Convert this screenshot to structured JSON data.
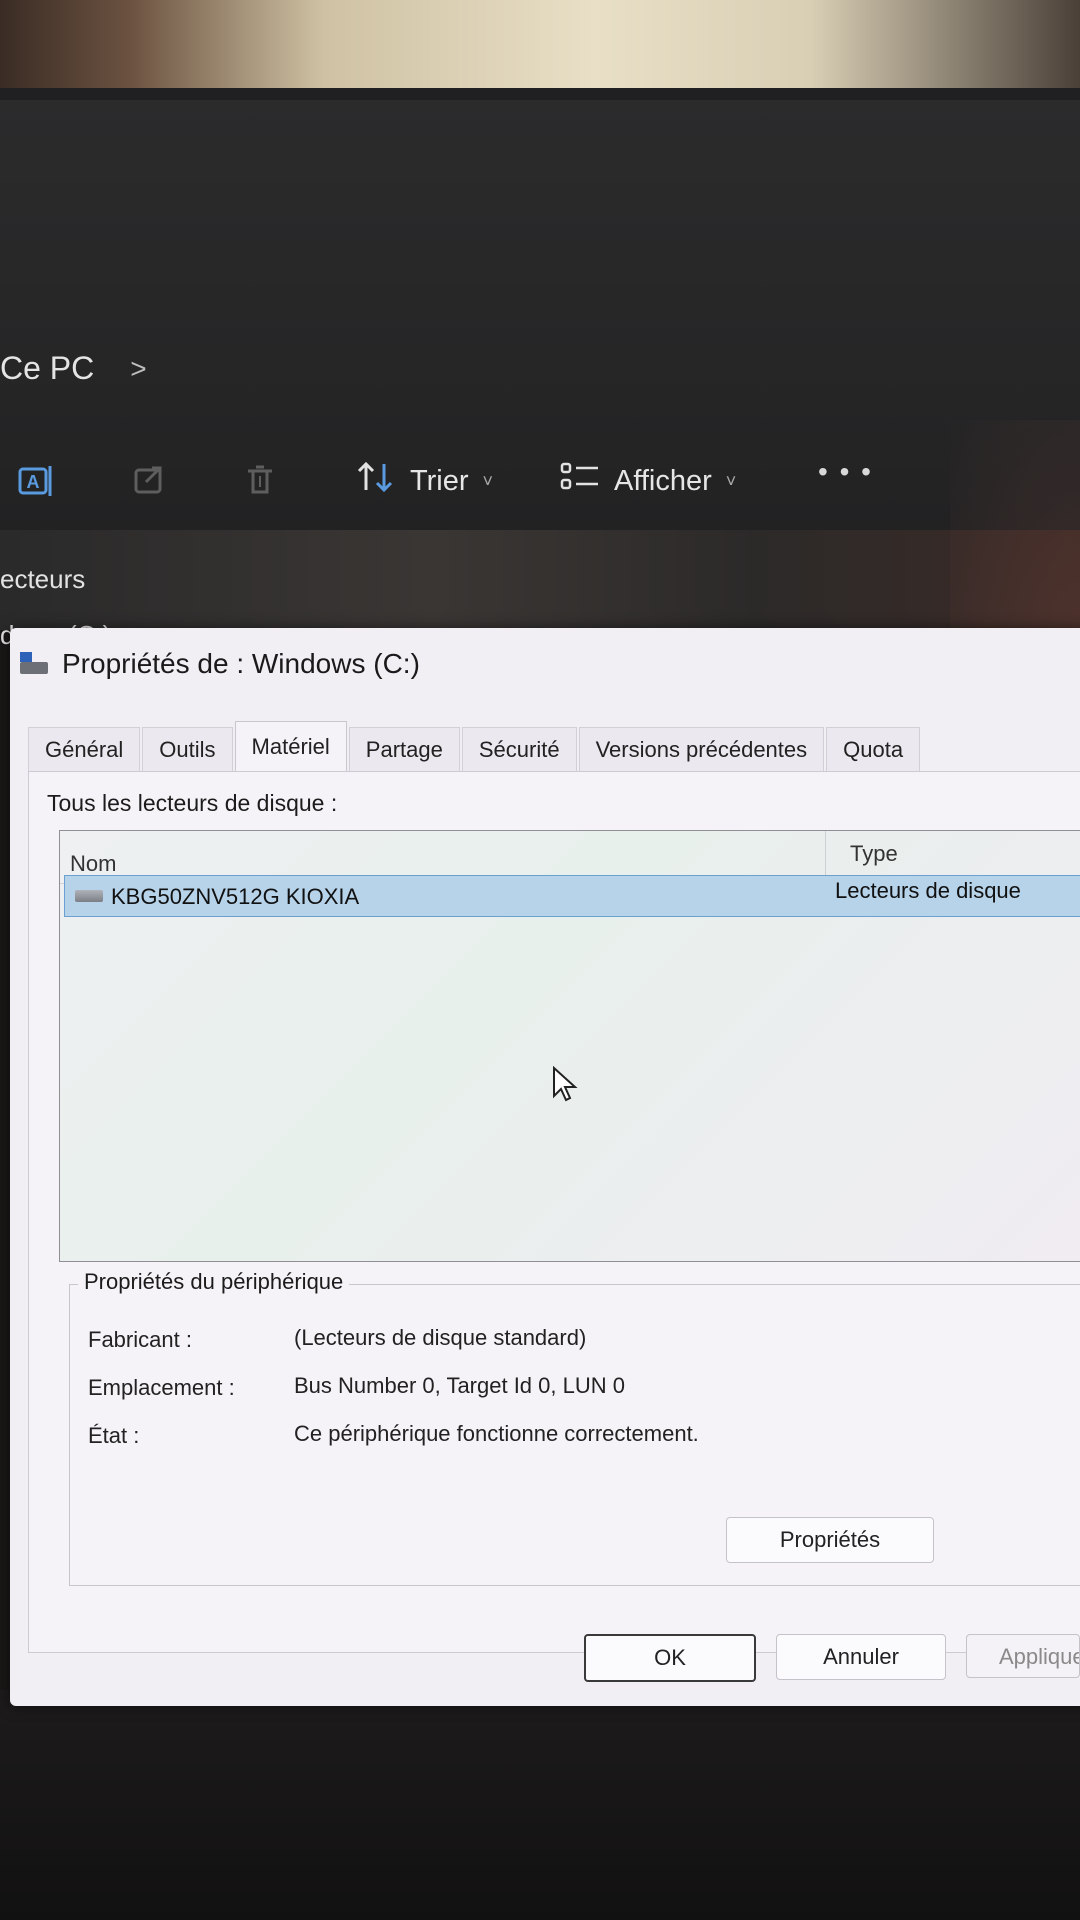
{
  "explorer": {
    "breadcrumb": "Ce PC",
    "breadcrumb_sep": ">",
    "toolbar": {
      "sort_label": "Trier",
      "view_label": "Afficher",
      "more_label": "• • •"
    },
    "nav": {
      "drives_label": "ecteurs",
      "windows_label": "dows (C:)"
    }
  },
  "dialog": {
    "title": "Propriétés de : Windows (C:)",
    "tabs": [
      "Général",
      "Outils",
      "Matériel",
      "Partage",
      "Sécurité",
      "Versions précédentes",
      "Quota"
    ],
    "active_tab": "Matériel",
    "list_label": "Tous les lecteurs de disque :",
    "columns": {
      "name": "Nom",
      "type": "Type"
    },
    "rows": [
      {
        "name": "KBG50ZNV512G KIOXIA",
        "type": "Lecteurs de disque"
      }
    ],
    "device_props": {
      "title": "Propriétés du périphérique",
      "manufacturer_label": "Fabricant :",
      "manufacturer_value": "(Lecteurs de disque standard)",
      "location_label": "Emplacement :",
      "location_value": "Bus Number 0, Target Id 0, LUN 0",
      "status_label": "État :",
      "status_value": "Ce périphérique fonctionne correctement.",
      "properties_button": "Propriétés"
    },
    "buttons": {
      "ok": "OK",
      "cancel": "Annuler",
      "apply": "Appliquer"
    }
  }
}
